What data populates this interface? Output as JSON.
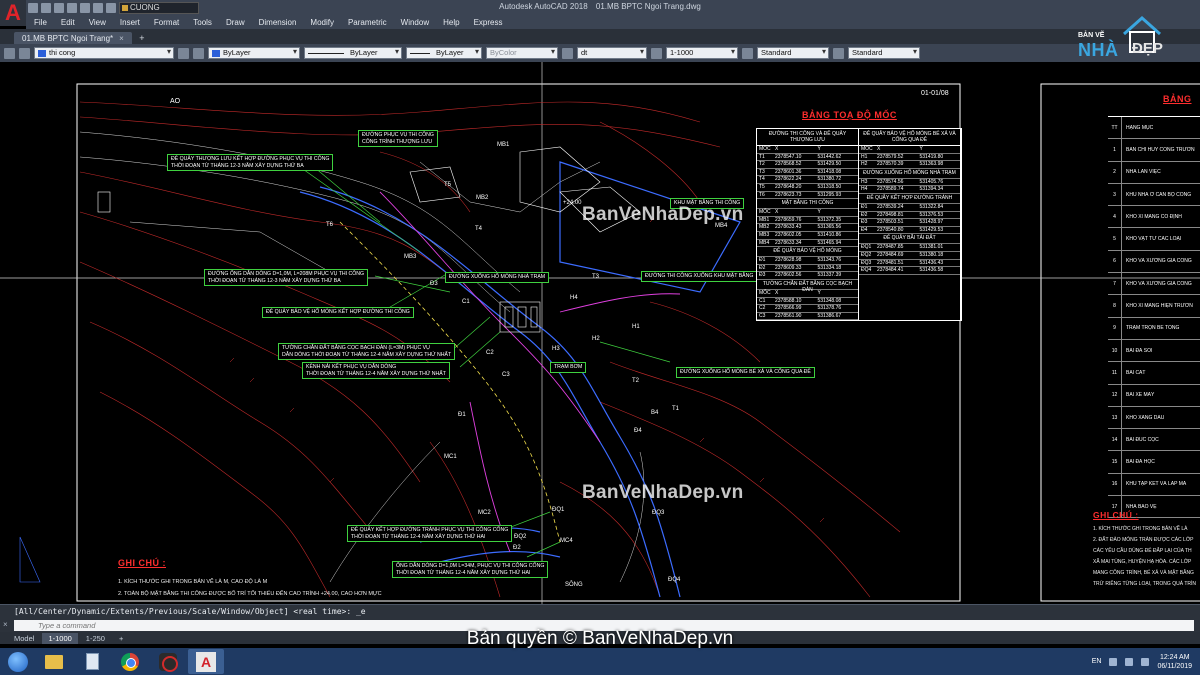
{
  "window": {
    "app_name": "Autodesk AutoCAD 2018",
    "file_name": "01.MB BPTC Ngoi Trang.dwg",
    "workspace": "CUONG"
  },
  "menu": [
    "File",
    "Edit",
    "View",
    "Insert",
    "Format",
    "Tools",
    "Draw",
    "Dimension",
    "Modify",
    "Parametric",
    "Window",
    "Help",
    "Express"
  ],
  "doc_tab": {
    "label": "01.MB BPTC Ngoi Trang*",
    "close": "×",
    "new": "+"
  },
  "properties": {
    "layer": "thi cong",
    "color": "ByLayer",
    "linetype": "ByLayer",
    "lineweight": "ByLayer",
    "plotstyle": "ByColor",
    "dimstyle": "dt",
    "scale": "1-1000",
    "textstyle": "Standard",
    "tablestyle": "Standard"
  },
  "drawing": {
    "sheet_code": "01-01/08",
    "table_title": "BẢNG TOẠ ĐỘ MỐC",
    "right_title": "BẢNG",
    "notes_title": "GHI CHÚ :",
    "notes": [
      "1. KÍCH THƯỚC GHI TRONG BẢN VẼ LÀ M, CAO ĐỘ LÀ M",
      "2. TOÀN BỘ MẶT BẰNG THI CÔNG ĐƯỢC BỐ TRÍ TỐI THIỂU ĐẾN CAO TRÌNH +24.00, CAO HƠN MỰC"
    ],
    "right_notes_title": "GHI CHÚ :",
    "right_notes": [
      "1. KÍCH THƯỚC GHI TRONG BẢN VẼ LÀ",
      "2. ĐẤT ĐÀO MÓNG TRÀN ĐƯỢC CÁC LỚP",
      "CÁC YÊU CẦU DÙNG ĐỂ ĐẮP LẠI CỦA TH",
      "XÃ MAI TÙNG, HUYỆN HẠ HÒA. CÁC LỚP",
      "MANG CÔNG TRÌNH, BỂ XẢ VÀ MẶT BẰNG",
      "TRỪ RIÊNG TỪNG LOẠI, TRONG QUÁ TRÌN"
    ],
    "watermark": "BanVeNhaDep.vn",
    "labels": {
      "ao": "AO",
      "road_service": "ĐƯỜNG PHỤC VỤ THI CÔNG\nCÔNG TRÌNH THƯỢNG LƯU",
      "dong_chay": "ĐÊ QUÂY THƯỢNG LƯU KẾT HỢP ĐƯỜNG PHỤC VỤ THI CÔNG\nTHỜI ĐOẠN TỪ THÁNG 12-3 NĂM XÂY DỰNG THỨ BA",
      "kenh_dan": "ĐƯỜNG ỐNG DẪN DÒNG D=1,0M, L=208M PHỤC VỤ THI CÔNG\nTHỜI ĐOẠN TỪ THÁNG 12-3 NĂM XÂY DỰNG THỨ BA",
      "de_quay_ha": "ĐÊ QUÂY BẢO VỆ HỐ MÓNG KẾT HỢP ĐƯỜNG THI CÔNG",
      "tuong_chan": "TƯỜNG CHẮN ĐẤT BẰNG CỌC BẠCH ĐÀN (L=3M) PHỤC VỤ\nDẪN DÒNG THỜI ĐOẠN TỪ THÁNG 12-4 NĂM XÂY DỰNG THỨ NHẤT",
      "kenh_nai": "KÊNH NẢI KẾT PHỤC VỤ DẪN DÒNG\nTHỜI ĐOẠN TỪ THÁNG 12-4 NĂM XÂY DỰNG THỨ NHẤT",
      "khu_mat_bang": "KHU MẶT BẰNG THI CÔNG",
      "duong_xuong": "ĐƯỜNG XUỐNG HỐ MÓNG NHÀ TRẠM",
      "duong_thi_cong": "ĐƯỜNG THI CÔNG XUỐNG KHU MẶT BẰNG",
      "duong_xuong_be": "ĐƯỜNG XUỐNG HỐ MÓNG BỂ XẢ VÀ CỐNG QUA ĐÊ",
      "tram_bom": "TRẠM BƠM",
      "de_quay_tam": "ĐÊ QUÂY KẾT HỢP ĐƯỜNG TRÁNH PHỤC VỤ THI CÔNG CỐNG\nTHỜI ĐOẠN TỪ THÁNG 12-4 NĂM XÂY DỰNG THỨ HAI",
      "ong_dan": "ỐNG DẪN DÒNG D=1,0M L=34M, PHỤC VỤ THI CÔNG CỐNG\nTHỜI ĐOẠN TỪ THÁNG 12-4 NĂM XÂY DỰNG THỨ HAI",
      "elev": "+24.00",
      "song": "SÔNG"
    },
    "point_labels": [
      "T1",
      "T2",
      "T3",
      "T4",
      "T5",
      "T6",
      "H1",
      "H2",
      "H3",
      "H4",
      "C1",
      "C2",
      "C3",
      "Đ1",
      "Đ2",
      "Đ3",
      "Đ4",
      "B4",
      "MB1",
      "MB2",
      "MB3",
      "MB4",
      "MC1",
      "MC2",
      "MC4",
      "ĐQ1",
      "ĐQ2",
      "ĐQ3",
      "ĐQ4"
    ]
  },
  "coord_table": {
    "left_header": "ĐƯỜNG THI CÔNG VÀ ĐÊ QUÂY THƯỢNG LƯU",
    "right_header": "ĐÊ QUÂY BẢO VỆ HỐ MÓNG BỂ XẢ VÀ CỐNG QUA ĐÊ",
    "col_labels": [
      "MỐC",
      "X",
      "Y"
    ],
    "left_rows": [
      [
        "T1",
        "2378547.10",
        "531442.62"
      ],
      [
        "T2",
        "2378568.52",
        "531429.50"
      ],
      [
        "T3",
        "2378601.36",
        "531418.08"
      ],
      [
        "T4",
        "2378622.24",
        "531380.72"
      ],
      [
        "T5",
        "2378648.20",
        "531318.50"
      ],
      [
        "T6",
        "2378623.73",
        "531295.93"
      ]
    ],
    "left_sub1": "MẶT BẰNG THI CÔNG",
    "left_rows2": [
      [
        "MB1",
        "2378659.76",
        "531372.35"
      ],
      [
        "MB2",
        "2378633.43",
        "531365.56"
      ],
      [
        "MB3",
        "2378602.05",
        "531410.86"
      ],
      [
        "MB4",
        "2378633.34",
        "531465.94"
      ]
    ],
    "left_sub2": "ĐÊ QUÂY BẢO VỆ HỐ MÓNG",
    "left_rows3": [
      [
        "Đ1",
        "2378628.98",
        "531343.76"
      ],
      [
        "Đ2",
        "2378609.33",
        "531334.18"
      ],
      [
        "Đ3",
        "2378602.56",
        "531337.39"
      ]
    ],
    "left_sub3": "TƯỜNG CHẮN ĐẤT BẰNG CỌC BẠCH ĐÀN",
    "left_rows4": [
      [
        "C1",
        "2378588.10",
        "531348.08"
      ],
      [
        "C2",
        "2378566.99",
        "531378.76"
      ],
      [
        "C3",
        "2378561.90",
        "531386.67"
      ]
    ],
    "right_rows": [
      [
        "H1",
        "2378579.52",
        "531419.80"
      ],
      [
        "H2",
        "2378570.39",
        "531363.98"
      ]
    ],
    "right_sub1": "ĐƯỜNG XUỐNG HỐ MÓNG NHÀ TRẠM",
    "right_rows2": [
      [
        "H3",
        "2378574.56",
        "531405.76"
      ],
      [
        "H4",
        "2378589.74",
        "531394.34"
      ]
    ],
    "right_sub2": "ĐÊ QUÂY KẾT HỢP ĐƯỜNG TRÁNH",
    "right_rows3": [
      [
        "Đ1",
        "2378539.24",
        "531322.84"
      ],
      [
        "Đ2",
        "2378498.81",
        "531376.53"
      ],
      [
        "Đ3",
        "2378503.51",
        "531428.97"
      ],
      [
        "Đ4",
        "2378540.80",
        "531429.53"
      ]
    ],
    "right_sub3": "ĐÊ QUÂY BÃI TẢI ĐẤT",
    "right_rows4": [
      [
        "ĐQ1",
        "2378487.85",
        "531381.01"
      ],
      [
        "ĐQ2",
        "2378484.69",
        "531380.18"
      ],
      [
        "ĐQ3",
        "2378481.51",
        "531436.43"
      ],
      [
        "ĐQ4",
        "2378484.41",
        "531436.58"
      ]
    ]
  },
  "legend": {
    "header": [
      "TT",
      "HẠNG MỤC"
    ],
    "rows": [
      [
        "1",
        "BAN CHỈ HUY CÔNG TRƯỜN"
      ],
      [
        "2",
        "NHÀ LÁN VIỆC"
      ],
      [
        "3",
        "KHU NHÀ Ở CÁN BỘ CÔNG"
      ],
      [
        "4",
        "KHO XI MĂNG CỐ ĐỊNH"
      ],
      [
        "5",
        "KHO VẬT TƯ CÁC LOẠI"
      ],
      [
        "6",
        "KHO VÀ XƯỞNG GIA CÔNG"
      ],
      [
        "7",
        "KHO VÀ XƯỞNG GIA CÔNG"
      ],
      [
        "8",
        "KHO XI MĂNG HIỆN TRƯỜN"
      ],
      [
        "9",
        "TRẠM TRỘN BÊ TÔNG"
      ],
      [
        "10",
        "BÃI ĐÁ SỎI"
      ],
      [
        "11",
        "BÃI CÁT"
      ],
      [
        "12",
        "BÃI XE MÁY"
      ],
      [
        "13",
        "KHO XĂNG DẦU"
      ],
      [
        "14",
        "BÃI ĐÚC CỌC"
      ],
      [
        "15",
        "BÃI ĐÁ HỘC"
      ],
      [
        "16",
        "KHU TẬP KẾT VÀ LẮP MÁ"
      ],
      [
        "17",
        "NHÀ BẢO VỆ"
      ]
    ]
  },
  "command": {
    "history": "[All/Center/Dynamic/Extents/Previous/Scale/Window/Object] <real time>: _e",
    "placeholder": "Type a command"
  },
  "layout_tabs": [
    "Model",
    "1-1000",
    "1-250",
    "+"
  ],
  "copyright": "Bản quyền © BanVeNhaDep.vn",
  "brand": {
    "line1": "BẢN VẼ",
    "line2": "NHÀ",
    "line3": "ĐẸP"
  },
  "taskbar": {
    "lang": "EN",
    "time": "12:24 AM",
    "date": "06/11/2019"
  }
}
